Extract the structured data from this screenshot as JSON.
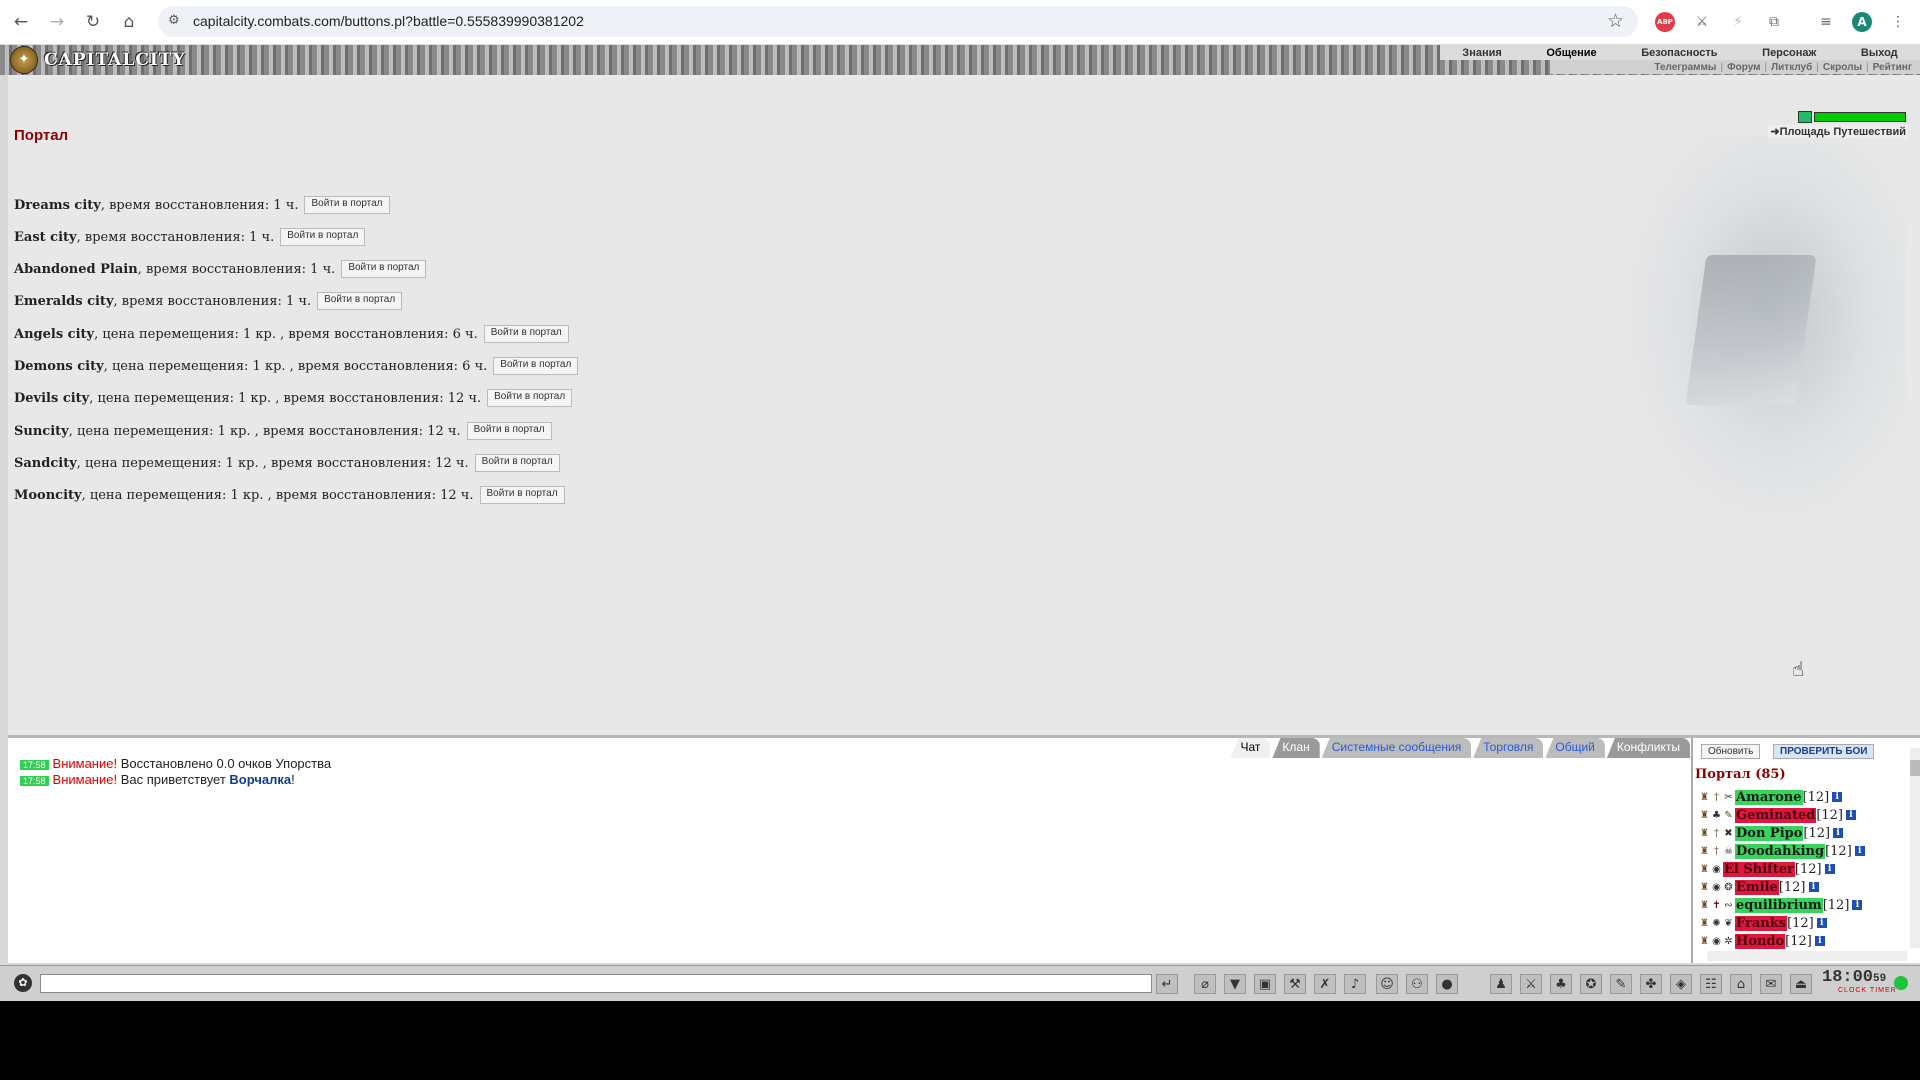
{
  "browser": {
    "url": "capitalcity.combats.com/buttons.pl?battle=0.555839990381202"
  },
  "game": {
    "logo_text": "CAPITALCITY",
    "menu_top": [
      "Знания",
      "Общение",
      "Безопасность",
      "Персонаж",
      "Выход"
    ],
    "menu_sub": [
      "Телеграммы",
      "Форум",
      "Литклуб",
      "Скролы",
      "Рейтинг"
    ],
    "travel_link": "Площадь Путешествий"
  },
  "portal": {
    "title": "Портал",
    "button_label": "Войти в портал",
    "cities": [
      {
        "name": "Dreams city",
        "desc": ", время восстановления: 1 ч."
      },
      {
        "name": "East city",
        "desc": ", время восстановления: 1 ч."
      },
      {
        "name": "Abandoned Plain",
        "desc": ", время восстановления: 1 ч."
      },
      {
        "name": "Emeralds city",
        "desc": ", время восстановления: 1 ч."
      },
      {
        "name": "Angels city",
        "desc": ", цена перемещения: 1 кр. , время восстановления: 6 ч."
      },
      {
        "name": "Demons city",
        "desc": ", цена перемещения: 1 кр. , время восстановления: 6 ч."
      },
      {
        "name": "Devils city",
        "desc": ", цена перемещения: 1 кр. , время восстановления: 12 ч."
      },
      {
        "name": "Suncity",
        "desc": ", цена перемещения: 1 кр. , время восстановления: 12 ч."
      },
      {
        "name": "Sandcity",
        "desc": ", цена перемещения: 1 кр. , время восстановления: 12 ч."
      },
      {
        "name": "Mooncity",
        "desc": ", цена перемещения: 1 кр. , время восстановления: 12 ч."
      }
    ]
  },
  "chat": {
    "tabs": [
      "Чат",
      "Клан",
      "Системные сообщения",
      "Торговля",
      "Общий",
      "Конфликты"
    ],
    "messages": [
      {
        "time": "17:58",
        "warn": "Внимание!",
        "text": " Восстановлено 0.0 очков Упорства",
        "nick": "",
        "tail": ""
      },
      {
        "time": "17:58",
        "warn": "Внимание!",
        "text": " Вас приветствует ",
        "nick": "Ворчалка",
        "tail": "!"
      }
    ]
  },
  "online": {
    "refresh_label": "Обновить",
    "check_label": "ПРОВЕРИТЬ БОИ",
    "title": "Портал (85)",
    "users": [
      {
        "name": "Amarone",
        "level": "[12]",
        "status": "green"
      },
      {
        "name": "Geminated",
        "level": "[12]",
        "status": "red"
      },
      {
        "name": "Don Pipo",
        "level": "[12]",
        "status": "green"
      },
      {
        "name": "Doodahking",
        "level": "[12]",
        "status": "green"
      },
      {
        "name": "El Shifter",
        "level": "[12]",
        "status": "red"
      },
      {
        "name": "Emile",
        "level": "[12]",
        "status": "red"
      },
      {
        "name": "equilibrium",
        "level": "[12]",
        "status": "green"
      },
      {
        "name": "Franks",
        "level": "[12]",
        "status": "red"
      },
      {
        "name": "Hondo",
        "level": "[12]",
        "status": "red"
      }
    ]
  },
  "bottombar": {
    "clock": "18:00",
    "seconds": "59",
    "clock_label": "CLOCK TIMER"
  },
  "colors": {
    "portal_title": "#8b0000",
    "online_green": "#37d45b",
    "online_red": "#e0163a",
    "warn": "#e00000"
  }
}
